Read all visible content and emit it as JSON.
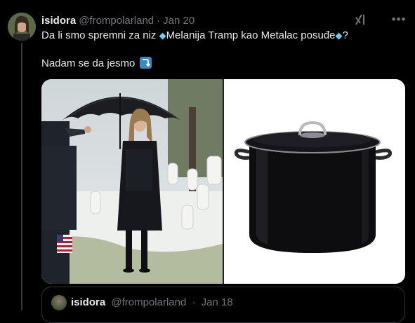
{
  "tweet": {
    "author_name": "isidora",
    "author_handle": "@frompolarland",
    "separator": "·",
    "date": "Jan 20",
    "text_line1_a": "Da li smo spremni za niz ",
    "text_line1_b": "Melanija Tramp kao Metalac posuđe",
    "text_line1_c": "?",
    "text_line2": "Nadam se da jesmo",
    "gem_icon": "gem-icon",
    "arrow_icon": "arrow-right-curving-down-icon"
  },
  "media": {
    "left_image": "photo-woman-umbrella-cemetery",
    "right_image": "photo-black-stock-pot"
  },
  "quote": {
    "author_name": "isidora",
    "author_handle": "@frompolarland",
    "separator": "·",
    "date": "Jan 18"
  },
  "colors": {
    "background": "#000000",
    "text": "#e7e9ea",
    "muted": "#71767b",
    "border": "#2f3336"
  }
}
